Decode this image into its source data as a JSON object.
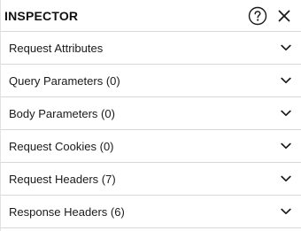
{
  "inspector": {
    "title": "INSPECTOR",
    "help_icon": "help-circle-icon",
    "close_icon": "close-icon",
    "sections": [
      {
        "label": "Request Attributes",
        "icon": "chevron-down-icon"
      },
      {
        "label": "Query Parameters (0)",
        "icon": "chevron-down-icon"
      },
      {
        "label": "Body Parameters (0)",
        "icon": "chevron-down-icon"
      },
      {
        "label": "Request Cookies (0)",
        "icon": "chevron-down-icon"
      },
      {
        "label": "Request Headers (7)",
        "icon": "chevron-down-icon"
      },
      {
        "label": "Response Headers (6)",
        "icon": "chevron-down-icon"
      }
    ]
  },
  "colors": {
    "text": "#1a1a1a",
    "divider": "#d8d8d8",
    "background": "#ffffff"
  }
}
